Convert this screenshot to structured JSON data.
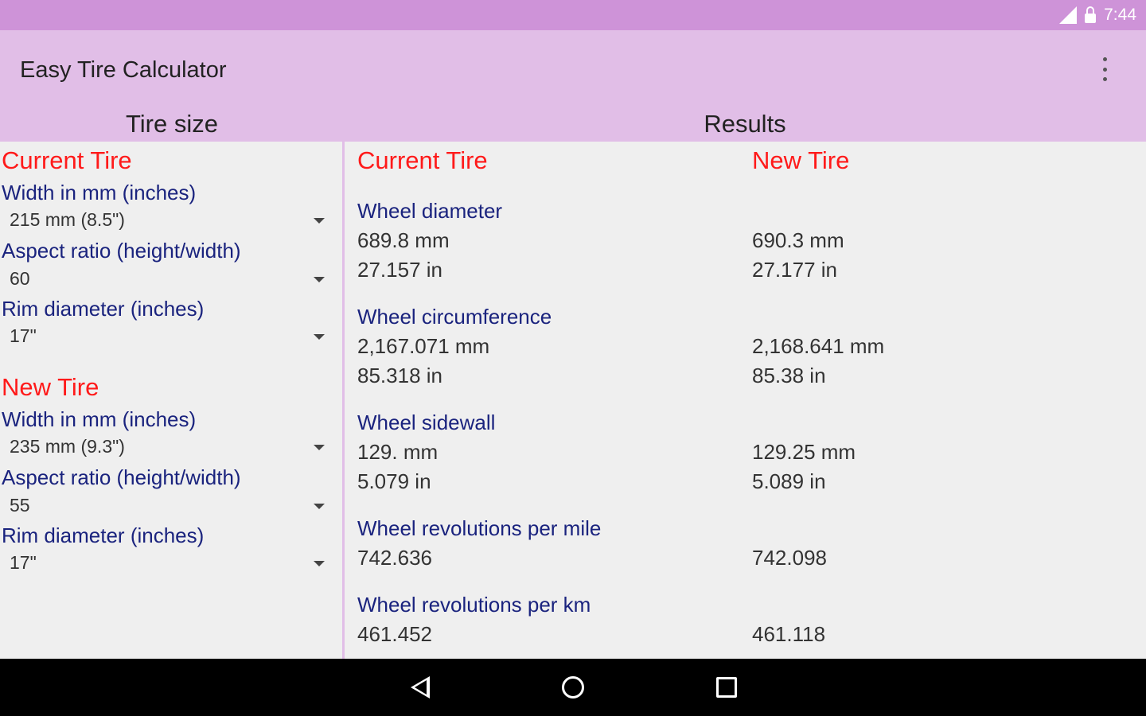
{
  "status_bar": {
    "time": "7:44"
  },
  "app": {
    "title": "Easy Tire Calculator"
  },
  "sections": {
    "left": "Tire size",
    "right": "Results"
  },
  "current_tire": {
    "heading": "Current Tire",
    "width_label": "Width in mm (inches)",
    "width_value": "215 mm (8.5\")",
    "aspect_label": "Aspect ratio (height/width)",
    "aspect_value": "60",
    "rim_label": "Rim diameter (inches)",
    "rim_value": "17\""
  },
  "new_tire": {
    "heading": "New Tire",
    "width_label": "Width in mm (inches)",
    "width_value": "235 mm (9.3\")",
    "aspect_label": "Aspect ratio (height/width)",
    "aspect_value": "55",
    "rim_label": "Rim diameter (inches)",
    "rim_value": "17\""
  },
  "results": {
    "current_heading": "Current Tire",
    "new_heading": "New Tire",
    "rows": [
      {
        "label": "Wheel diameter",
        "current": [
          "689.8 mm",
          "27.157 in"
        ],
        "new": [
          "690.3 mm",
          "27.177 in"
        ]
      },
      {
        "label": "Wheel circumference",
        "current": [
          "2,167.071 mm",
          "85.318 in"
        ],
        "new": [
          "2,168.641 mm",
          "85.38 in"
        ]
      },
      {
        "label": "Wheel sidewall",
        "current": [
          "129. mm",
          "5.079 in"
        ],
        "new": [
          "129.25 mm",
          "5.089 in"
        ]
      },
      {
        "label": "Wheel revolutions per mile",
        "current": [
          "742.636"
        ],
        "new": [
          "742.098"
        ]
      },
      {
        "label": "Wheel revolutions per km",
        "current": [
          "461.452"
        ],
        "new": [
          "461.118"
        ]
      }
    ]
  }
}
